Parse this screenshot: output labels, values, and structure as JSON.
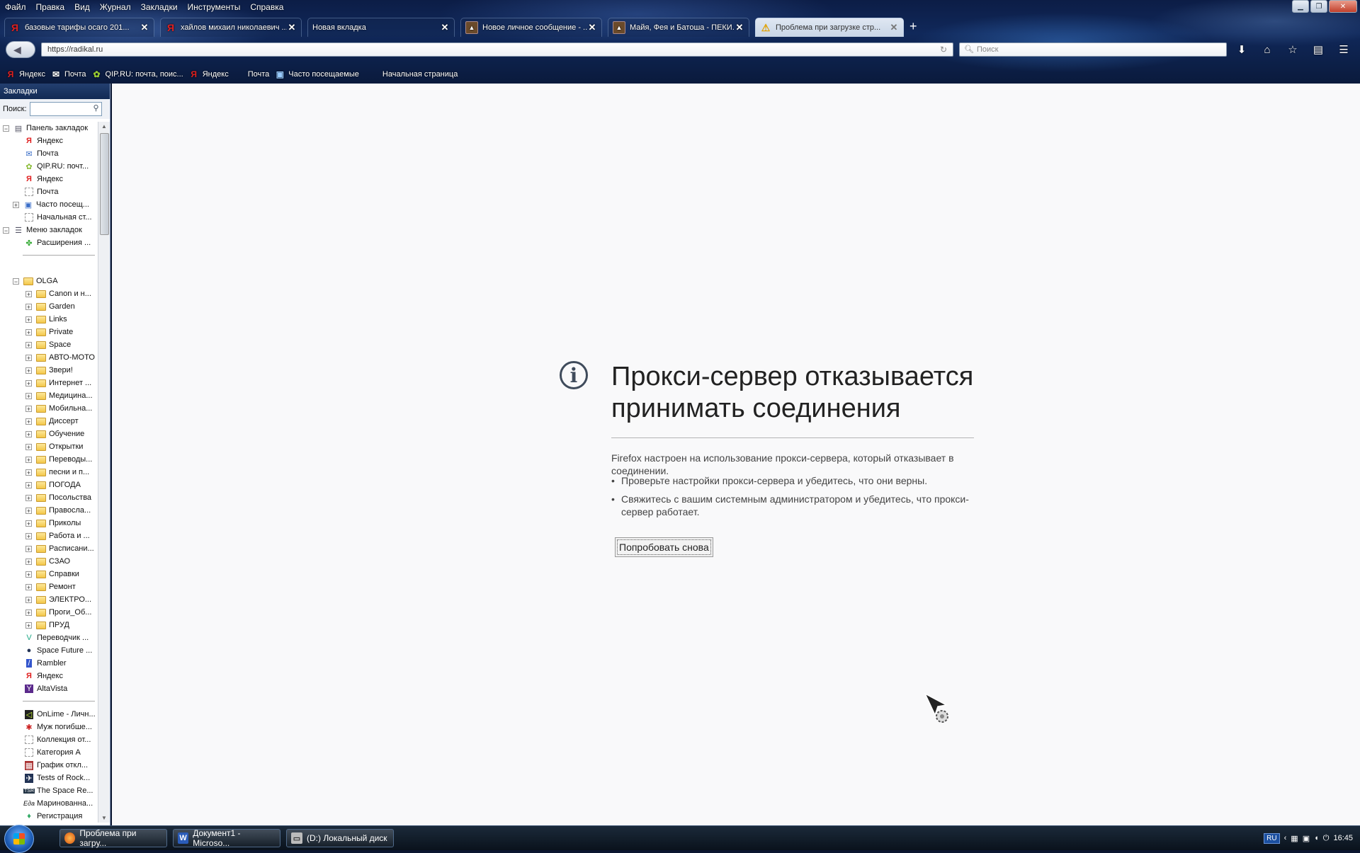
{
  "menubar": [
    "Файл",
    "Правка",
    "Вид",
    "Журнал",
    "Закладки",
    "Инструменты",
    "Справка"
  ],
  "tabs": [
    {
      "label": "базовые тарифы осаго 201...",
      "icon": "yandex-icon"
    },
    {
      "label": "хайлов михаил николаевич ...",
      "icon": "yandex-icon"
    },
    {
      "label": "Новая вкладка",
      "icon": ""
    },
    {
      "label": "Новое личное сообщение - ...",
      "icon": "forum-icon"
    },
    {
      "label": "Майя, Фея и Батоша - ПЕКИ...",
      "icon": "forum-icon"
    },
    {
      "label": "Проблема при загрузке стр...",
      "icon": "warning-icon"
    }
  ],
  "url": "https://radikal.ru",
  "search_placeholder": "Поиск",
  "bookmarks_bar": [
    {
      "label": "Яндекс",
      "icon": "yandex-icon"
    },
    {
      "label": "Почта",
      "icon": "mail-icon"
    },
    {
      "label": "QIP.RU: почта, поис...",
      "icon": "qip-icon"
    },
    {
      "label": "Яндекс",
      "icon": "yandex-icon"
    },
    {
      "label": "Почта",
      "icon": "blank-icon"
    },
    {
      "label": "Часто посещаемые",
      "icon": "frequent-icon"
    },
    {
      "label": "Начальная страница",
      "icon": "blank-icon"
    }
  ],
  "sidebar": {
    "title": "Закладки",
    "search_label": "Поиск:",
    "top_items": [
      {
        "label": "Панель закладок",
        "level": 0,
        "expander": "⊟",
        "icon": "bookmark-toolbar-icon"
      },
      {
        "label": "Яндекс",
        "level": 1,
        "icon": "yandex-icon"
      },
      {
        "label": "Почта",
        "level": 1,
        "icon": "mail-icon"
      },
      {
        "label": "QIP.RU: почт...",
        "level": 1,
        "icon": "qip-icon"
      },
      {
        "label": "Яндекс",
        "level": 1,
        "icon": "yandex-icon"
      },
      {
        "label": "Почта",
        "level": 1,
        "icon": "blank-icon"
      },
      {
        "label": "Часто посещ...",
        "level": 1,
        "expander": "⊞",
        "icon": "frequent-icon"
      },
      {
        "label": "Начальная ст...",
        "level": 1,
        "icon": "blank-icon"
      },
      {
        "label": "Меню закладок",
        "level": 0,
        "expander": "⊟",
        "icon": "bookmark-menu-icon"
      },
      {
        "label": "Расширения ...",
        "level": 1,
        "icon": "addon-icon"
      }
    ],
    "olga": {
      "label": "OLGA"
    },
    "folders": [
      "Canon и н...",
      "Garden",
      "Links",
      "Private",
      "Space",
      "АВТО-МОТО",
      "Звери!",
      "Интернет ...",
      "Медицина...",
      "Мобильна...",
      "Диссерт",
      "Обучение",
      "Открытки",
      "Переводы...",
      "песни и п...",
      "ПОГОДА",
      "Посольства",
      "Правосла...",
      "Приколы",
      "Работа и ...",
      "Расписани...",
      "СЗАО",
      "Справки",
      "Ремонт",
      "ЭЛЕКТРО...",
      "Проги_Об...",
      "ПРУД"
    ],
    "links": [
      {
        "label": "Переводчик ...",
        "icon": "translate-icon"
      },
      {
        "label": "Space Future ...",
        "icon": "globe-icon"
      },
      {
        "label": "Rambler",
        "icon": "rambler-icon"
      },
      {
        "label": "Яндекс",
        "icon": "yandex-icon"
      },
      {
        "label": "AltaVista",
        "icon": "altavista-icon"
      }
    ],
    "links2": [
      {
        "label": "OnLime - Личн...",
        "icon": "onlime-icon"
      },
      {
        "label": "Муж погибше...",
        "icon": "star-icon"
      },
      {
        "label": "Коллекция от...",
        "icon": "blank-icon"
      },
      {
        "label": "Категория А",
        "icon": "blank-icon"
      },
      {
        "label": "График откл...",
        "icon": "schedule-icon"
      },
      {
        "label": "Tests of Rock...",
        "icon": "rocket-icon"
      },
      {
        "label": "The Space Re...",
        "icon": "tsr-icon"
      },
      {
        "label": "Маринованна...",
        "icon": "eda-icon"
      },
      {
        "label": "Регистрация",
        "icon": "register-icon"
      }
    ]
  },
  "error": {
    "title": "Прокси-сервер отказывается принимать соединения",
    "description": "Firefox настроен на использование прокси-сервера, который отказывает в соединении.",
    "bullets": [
      "Проверьте настройки прокси-сервера и убедитесь, что они верны.",
      "Свяжитесь с вашим системным администратором и убедитесь, что прокси-сервер работает."
    ],
    "retry_label": "Попробовать снова"
  },
  "taskbar": {
    "items": [
      {
        "label": "Проблема при загру...",
        "icon": "firefox-icon"
      },
      {
        "label": "Документ1 - Microso...",
        "icon": "word-icon"
      },
      {
        "label": "(D:) Локальный диск",
        "icon": "drive-icon"
      }
    ],
    "lang": "RU",
    "clock": "16:45"
  }
}
